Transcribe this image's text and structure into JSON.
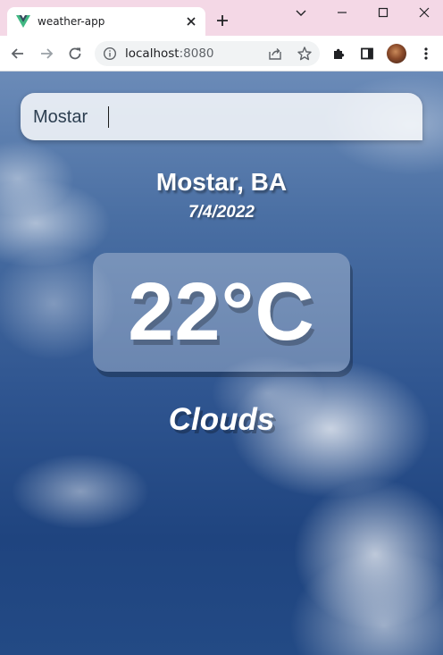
{
  "browser": {
    "tab": {
      "title": "weather-app",
      "favicon": "vue-logo-icon"
    },
    "address_bar": {
      "host": "localhost",
      "port": ":8080"
    },
    "colors": {
      "tabstrip": "#f4d8e6",
      "toolbar": "#ffffff",
      "omnibox": "#f1f3f4"
    }
  },
  "app": {
    "search": {
      "value": "Mostar",
      "placeholder": ""
    },
    "location": "Mostar, BA",
    "date": "7/4/2022",
    "temperature": "22°C",
    "weather": "Clouds",
    "background": "cloudy-sky"
  }
}
